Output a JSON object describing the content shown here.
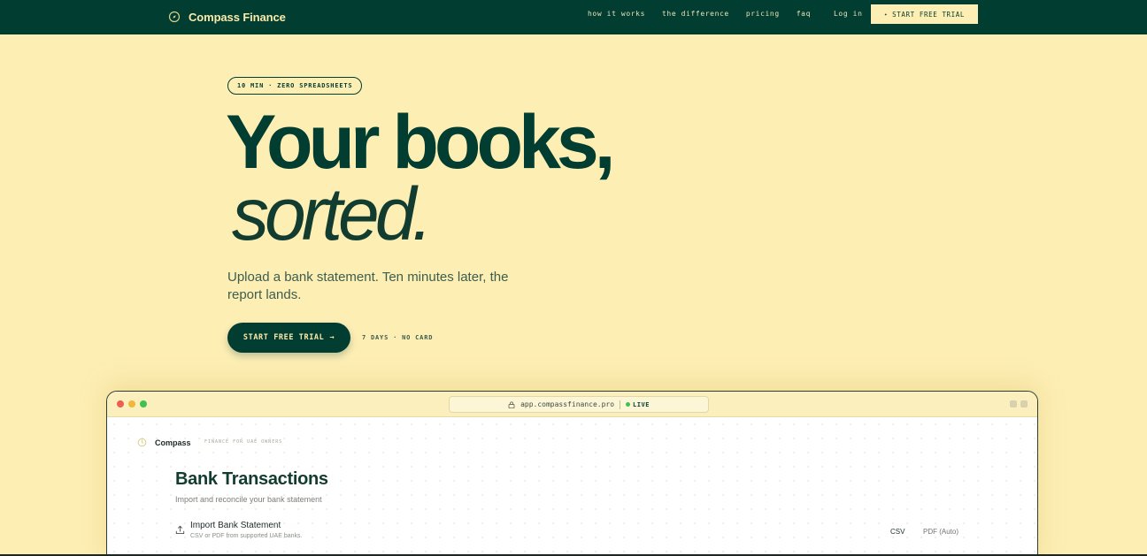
{
  "nav": {
    "brand": "Compass Finance",
    "brand_icon": "compass-icon",
    "links": [
      "how it works",
      "the difference",
      "pricing",
      "faq"
    ],
    "login": "Log in",
    "trial_button": "START FREE TRIAL",
    "trial_icon": "star-icon"
  },
  "hero": {
    "pill": "10 MIN · ZERO SPREADSHEETS",
    "headline_line1": "Your books,",
    "headline_line2": "sorted.",
    "subtitle": "Upload a bank statement. Ten minutes later, the report lands.",
    "cta": "START FREE TRIAL",
    "cta_arrow": "→",
    "cta_note": "7 DAYS · NO CARD"
  },
  "browser": {
    "url": "app.compassfinance.pro",
    "live": "LIVE"
  },
  "app": {
    "name": "Compass",
    "tagline": "FINANCE FOR UAE OWNERS",
    "page_title": "Bank Transactions",
    "page_subtitle": "Import and reconcile your bank statement",
    "import_title": "Import Bank Statement",
    "import_subtitle": "CSV or PDF from supported UAE banks.",
    "formats": [
      "CSV",
      "PDF (Auto)"
    ]
  },
  "colors": {
    "primary": "#023d32",
    "background": "#fdeeb4",
    "accent": "#fbeaa9",
    "live": "#3fc24f"
  }
}
